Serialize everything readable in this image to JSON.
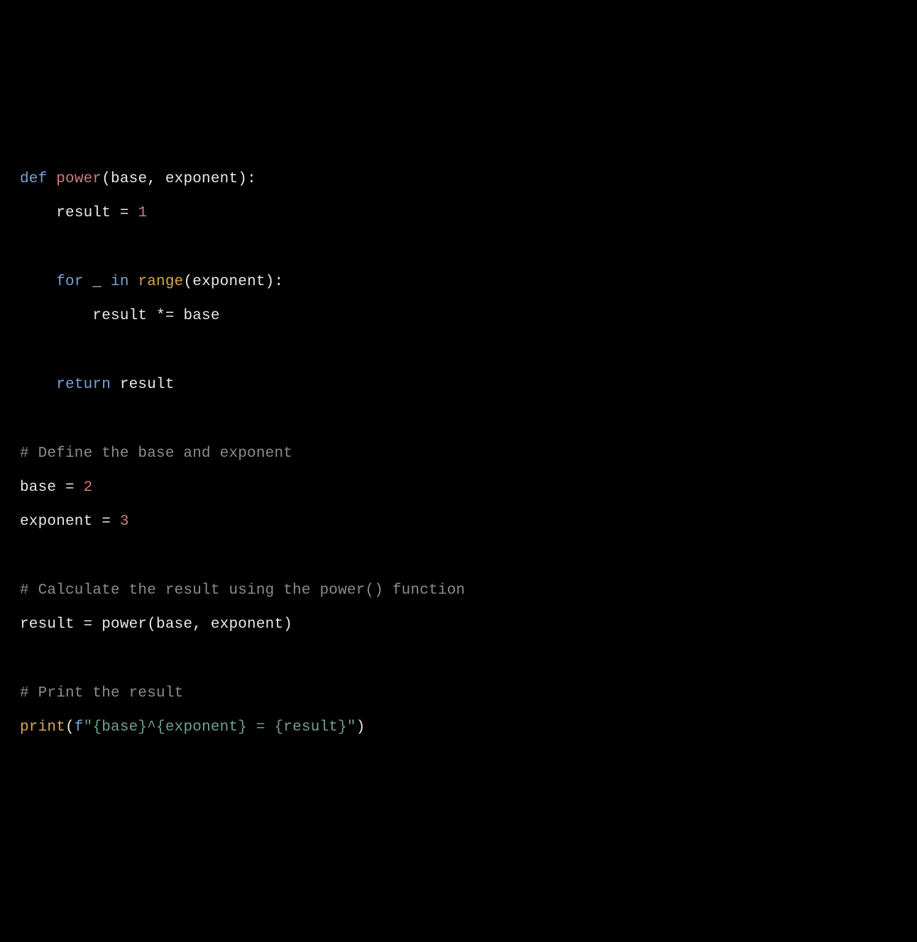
{
  "code": {
    "line1": {
      "def": "def",
      "space1": " ",
      "fn": "power",
      "params": "(base, exponent):"
    },
    "line2": {
      "indent": "    ",
      "text": "result = ",
      "num": "1"
    },
    "line4": {
      "indent": "    ",
      "for": "for",
      "mid1": " _ ",
      "in": "in",
      "space": " ",
      "range": "range",
      "tail": "(exponent):"
    },
    "line5": {
      "indent": "        ",
      "text": "result *= base"
    },
    "line7": {
      "indent": "    ",
      "return": "return",
      "tail": " result"
    },
    "line9": {
      "comment": "# Define the base and exponent"
    },
    "line10": {
      "text": "base = ",
      "num": "2"
    },
    "line11": {
      "text": "exponent = ",
      "num": "3"
    },
    "line13": {
      "comment": "# Calculate the result using the power() function"
    },
    "line14": {
      "text": "result = power(base, exponent)"
    },
    "line16": {
      "comment": "# Print the result"
    },
    "line17": {
      "print": "print",
      "open": "(",
      "f": "f",
      "str": "\"{base}^{exponent} = {result}\"",
      "close": ")"
    }
  }
}
